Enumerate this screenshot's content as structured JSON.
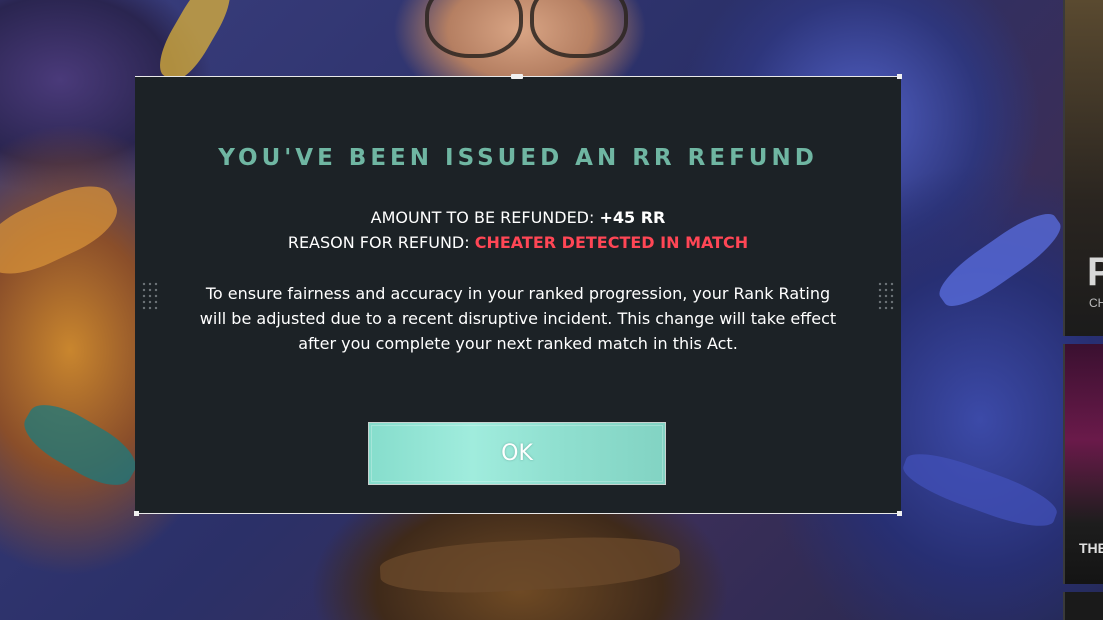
{
  "dialog": {
    "title": "YOU'VE BEEN ISSUED AN RR REFUND",
    "amount_label": "AMOUNT TO BE REFUNDED:",
    "amount_value": "+45 RR",
    "reason_label": "REASON FOR REFUND:",
    "reason_value": "CHEATER DETECTED IN MATCH",
    "description": "To ensure fairness and accuracy in your ranked progression, your Rank Rating will be adjusted due to a recent disruptive incident. This change will take effect after you complete your next ranked match in this Act.",
    "ok_label": "OK"
  },
  "side_panels": {
    "panel1_letter": "P",
    "panel1_sub": "CH",
    "panel2_text": "THE"
  },
  "colors": {
    "title": "#6fb6a2",
    "reason_value": "#ff4655",
    "modal_bg": "#1c2226",
    "ok_button": "#93e3d3"
  }
}
